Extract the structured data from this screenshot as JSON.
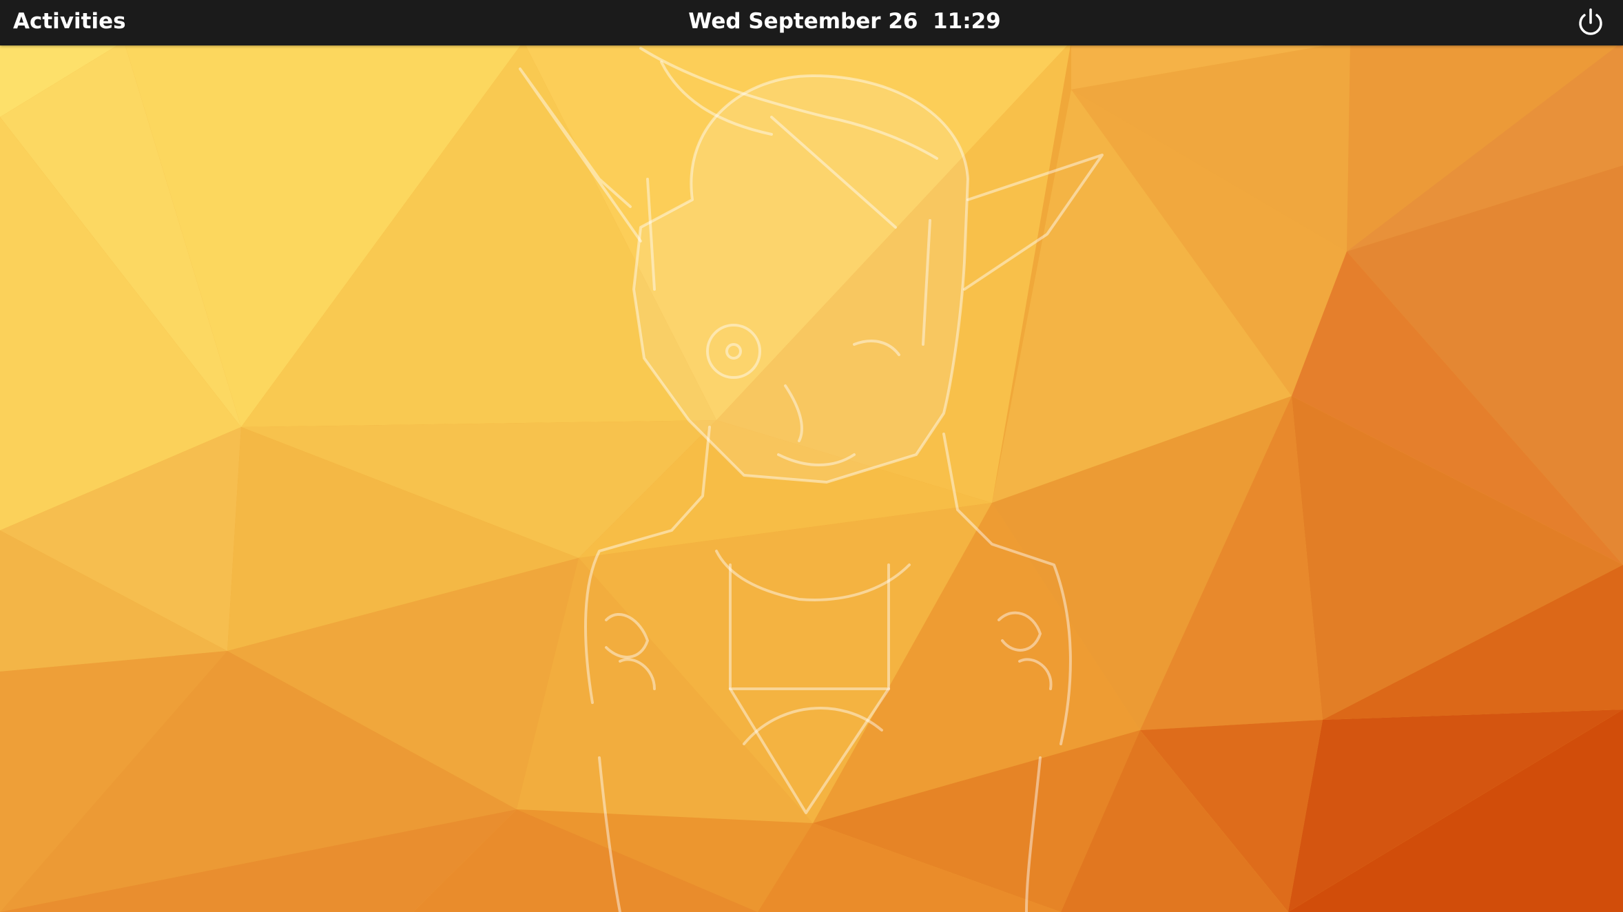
{
  "topbar": {
    "activities_label": "Activities",
    "clock_text": "Wed September 26  11:29",
    "power_icon": "power-icon"
  },
  "wallpaper": {
    "description": "low-poly yellow-orange triangles with a faint white line sketch",
    "colors": {
      "light_yellow": "#fcd862",
      "mid_orange": "#f0a83a",
      "deep_orange": "#d4500a"
    }
  },
  "colors": {
    "top_bar_bg": "#1b1b1b",
    "top_bar_text": "#ffffff"
  }
}
